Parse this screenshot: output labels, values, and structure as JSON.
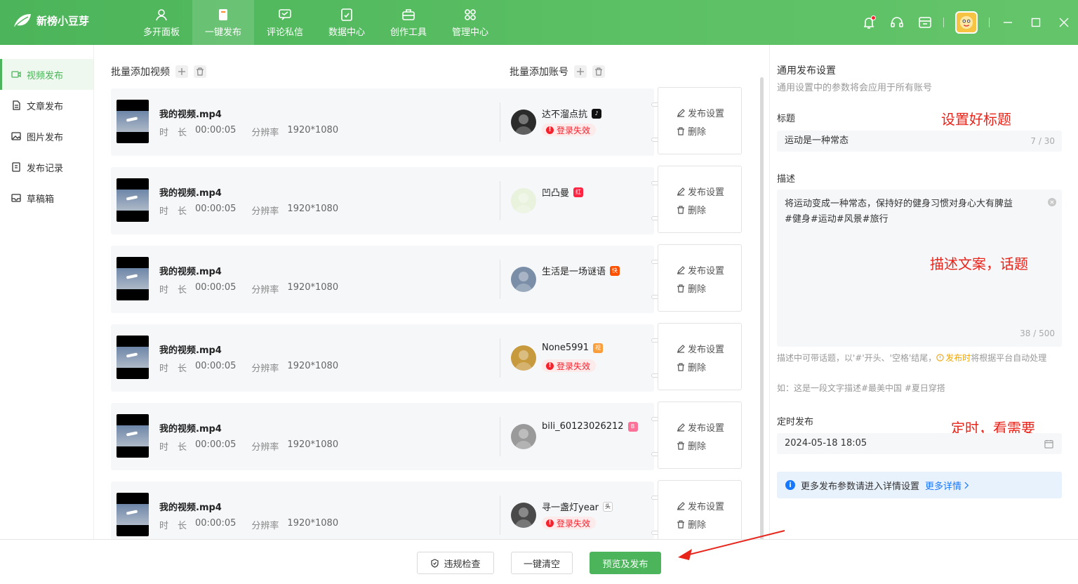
{
  "app": {
    "name": "新榜小豆芽"
  },
  "nav": [
    {
      "label": "多开面板",
      "icon": "user-icon"
    },
    {
      "label": "一键发布",
      "icon": "publish-icon"
    },
    {
      "label": "评论私信",
      "icon": "message-icon"
    },
    {
      "label": "数据中心",
      "icon": "data-icon"
    },
    {
      "label": "创作工具",
      "icon": "toolbox-icon"
    },
    {
      "label": "管理中心",
      "icon": "grid-icon"
    }
  ],
  "sidebar": [
    {
      "label": "视频发布",
      "icon": "video-icon"
    },
    {
      "label": "文章发布",
      "icon": "article-icon"
    },
    {
      "label": "图片发布",
      "icon": "image-icon"
    },
    {
      "label": "发布记录",
      "icon": "record-icon"
    },
    {
      "label": "草稿箱",
      "icon": "draft-icon"
    }
  ],
  "middle": {
    "add_videos": "批量添加视频",
    "add_accounts": "批量添加账号",
    "duration_label": "时　长",
    "resolution_label": "分辨率",
    "action_settings": "发布设置",
    "action_delete": "删除",
    "status_fail": "登录失效",
    "rows": [
      {
        "video": "我的视频.mp4",
        "duration": "00:00:05",
        "resolution": "1920*1080",
        "account": "达不溜点抗",
        "platform": "douyin"
      },
      {
        "video": "我的视频.mp4",
        "duration": "00:00:05",
        "resolution": "1920*1080",
        "account": "凹凸曼",
        "platform": "xiaohongshu"
      },
      {
        "video": "我的视频.mp4",
        "duration": "00:00:05",
        "resolution": "1920*1080",
        "account": "生活是一场谜语",
        "platform": "kuaishou"
      },
      {
        "video": "我的视频.mp4",
        "duration": "00:00:05",
        "resolution": "1920*1080",
        "account": "None5991",
        "platform": "channels"
      },
      {
        "video": "我的视频.mp4",
        "duration": "00:00:05",
        "resolution": "1920*1080",
        "account": "bili_60123026212",
        "platform": "bilibili"
      },
      {
        "video": "我的视频.mp4",
        "duration": "00:00:05",
        "resolution": "1920*1080",
        "account": "寻一盏灯year",
        "platform": "toutiao"
      }
    ]
  },
  "settings": {
    "title": "通用发布设置",
    "subtitle": "通用设置中的参数将会应用于所有账号",
    "title_label": "标题",
    "title_value": "运动是一种常态",
    "title_count": "7 / 30",
    "desc_label": "描述",
    "desc_line1": "将运动变成一种常态，保持好的健身习惯对身心大有脾益",
    "desc_line2": "#健身#运动#风景#旅行",
    "desc_count": "38 / 500",
    "hint_pre": "描述中可带话题，以'#'开头、'空格'结尾，",
    "hint_warn": "发布时",
    "hint_post": "将根据平台自动处理",
    "hint_example": "如：这是一段文字描述#最美中国 #夏日穿搭",
    "schedule_label": "定时发布",
    "schedule_value": "2024-05-18 18:05",
    "info_text": "更多发布参数请进入详情设置",
    "info_link": "更多详情"
  },
  "annotations": {
    "title": "设置好标题",
    "desc": "描述文案，话题",
    "schedule": "定时，看需要"
  },
  "bottom": {
    "check": "违规检查",
    "clear": "一键清空",
    "publish": "预览及发布"
  },
  "colors": {
    "brand": "#4cb45a",
    "danger": "#f5222d",
    "annotation": "#e8251b"
  }
}
